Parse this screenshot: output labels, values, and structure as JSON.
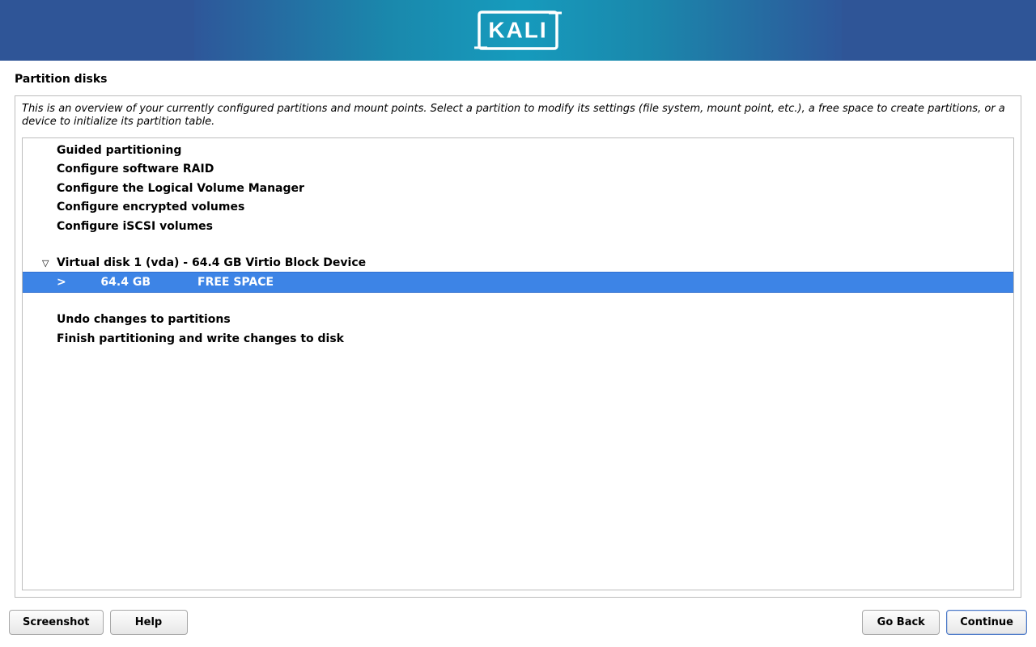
{
  "brand": "KALI",
  "title": "Partition disks",
  "instructions": "This is an overview of your currently configured partitions and mount points. Select a partition to modify its settings (file system, mount point, etc.), a free space to create partitions, or a device to initialize its partition table.",
  "menu": {
    "guided": "Guided partitioning",
    "raid": "Configure software RAID",
    "lvm": "Configure the Logical Volume Manager",
    "encrypted": "Configure encrypted volumes",
    "iscsi": "Configure iSCSI volumes"
  },
  "device": {
    "label": "Virtual disk 1 (vda) - 64.4 GB Virtio Block Device"
  },
  "selected_row": {
    "marker": ">",
    "size": "64.4 GB",
    "desc": "FREE SPACE"
  },
  "actions": {
    "undo": "Undo changes to partitions",
    "finish": "Finish partitioning and write changes to disk"
  },
  "buttons": {
    "screenshot": "Screenshot",
    "help": "Help",
    "goback": "Go Back",
    "continue": "Continue"
  }
}
